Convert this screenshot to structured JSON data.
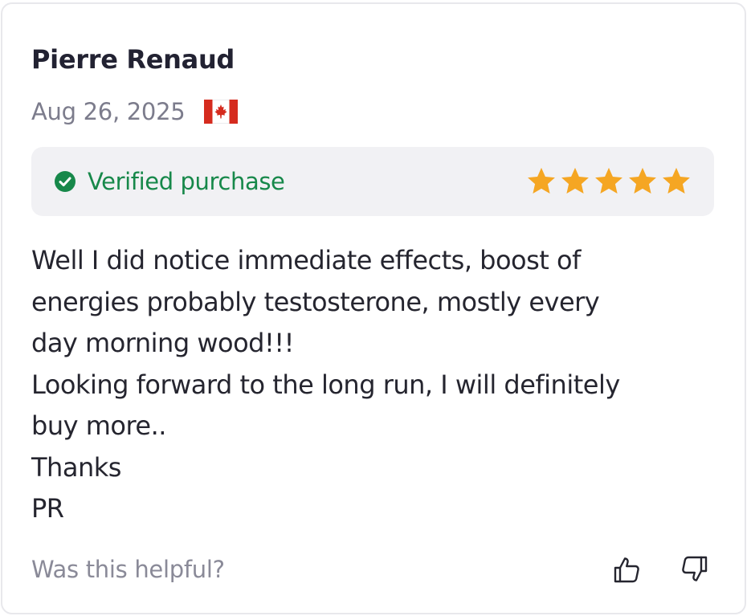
{
  "review": {
    "author": "Pierre Renaud",
    "date": "Aug 26, 2025",
    "country_flag": "canada-flag-icon",
    "verified_label": "Verified purchase",
    "rating": 5,
    "rating_max": 5,
    "body_lines": [
      "Well I did notice immediate effects, boost of",
      "energies probably testosterone, mostly every",
      "day morning wood!!!",
      "Looking forward to the long run, I will definitely",
      "buy more..",
      "Thanks",
      "PR"
    ],
    "helpful_question": "Was this helpful?"
  },
  "colors": {
    "verified_green": "#17884a",
    "star_gold": "#f5a623",
    "text_dark": "#25252f",
    "muted_gray": "#7c7c8c",
    "badge_bg": "#f1f1f4"
  },
  "icons": {
    "verified": "check-circle-icon",
    "star": "star-icon",
    "helpful_yes": "thumbs-up-icon",
    "helpful_no": "thumbs-down-icon"
  }
}
